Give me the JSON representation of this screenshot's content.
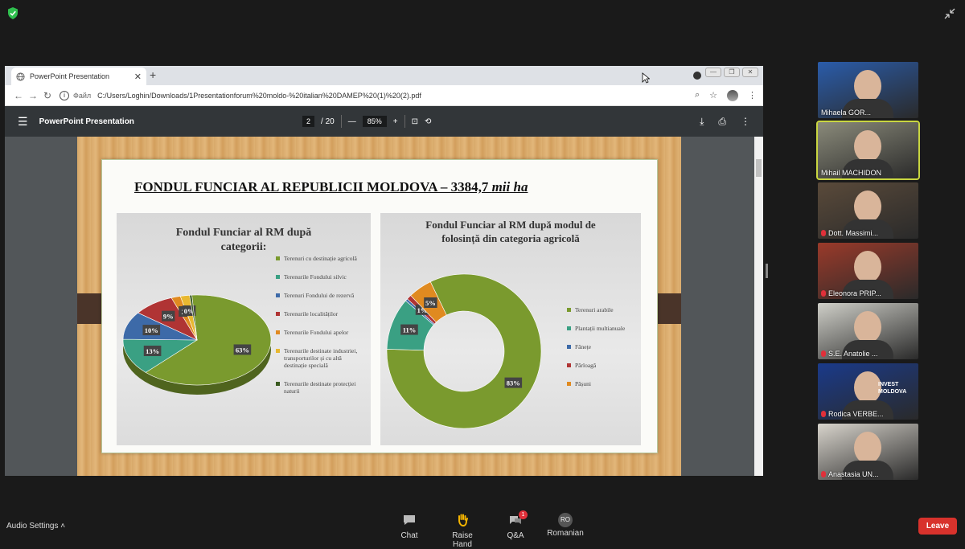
{
  "browser": {
    "tab_title": "PowerPoint Presentation",
    "tab_close": "✕",
    "new_tab": "+",
    "file_label": "Файл",
    "url": "C:/Users/Loghin/Downloads/1Presentationforum%20moldo-%20italian%20DAMEP%20(1)%20(2).pdf"
  },
  "pdf": {
    "title": "PowerPoint Presentation",
    "page_current": "2",
    "page_total": "/ 20",
    "zoom": "85%"
  },
  "slide": {
    "title_main": "FONDUL FUNCIAR AL REPUBLICII MOLDOVA  – 3384,7 ",
    "title_unit": "mii ha",
    "left_title_1": "Fondul Funciar al RM după",
    "left_title_2": "categorii:",
    "right_title_1": "Fondul Funciar al RM după modul de",
    "right_title_2": "folosință din categoria agricolă"
  },
  "chart_data": [
    {
      "type": "pie",
      "title": "Fondul Funciar al RM după categorii:",
      "categories": [
        "Terenuri cu destinație agricolă",
        "Terenurile Fondului silvic",
        "Terenuri Fondului de rezervă",
        "Terenurile localităților",
        "Terenurile Fondului apelor",
        "Terenurile destinate industriei, transporturilor și cu altă destinație specială",
        "Terenurile destinate protecției naturii"
      ],
      "labels": [
        "63%",
        "13%",
        "10%",
        "9%",
        "2",
        "0%",
        ""
      ],
      "values": [
        63,
        13,
        10,
        9,
        2,
        2,
        0.5
      ],
      "colors": [
        "#7a9a2e",
        "#3aa083",
        "#3d6aa8",
        "#b03434",
        "#e08a20",
        "#e8b830",
        "#3a5a20"
      ]
    },
    {
      "type": "pie",
      "title": "Fondul Funciar al RM după modul de folosință din categoria agricolă",
      "categories": [
        "Terenuri arabile",
        "Plantații multianuale",
        "Fânețe",
        "Pârloagă",
        "Pășuni"
      ],
      "labels": [
        "83%",
        "11%",
        "",
        "1%",
        "5%"
      ],
      "values": [
        83,
        11,
        0.5,
        1,
        5
      ],
      "colors": [
        "#7a9a2e",
        "#3aa083",
        "#3d6aa8",
        "#b03434",
        "#e08a20"
      ]
    }
  ],
  "participants": [
    {
      "name": "Mihaela GOR...",
      "bg": "#2a5caa",
      "active": false,
      "muted": false
    },
    {
      "name": "Mihail MACHIDON",
      "bg": "#8a8a7a",
      "active": true,
      "muted": false
    },
    {
      "name": "Dott. Massimi...",
      "bg": "#5a4a3a",
      "active": false,
      "muted": true
    },
    {
      "name": "Eleonora PRIP...",
      "bg": "#9a3a2a",
      "active": false,
      "muted": true
    },
    {
      "name": "S.E. Anatolie ...",
      "bg": "#cfcfc8",
      "active": false,
      "muted": true
    },
    {
      "name": "Rodica VERBE...",
      "bg": "#1a3a8a",
      "active": false,
      "muted": true
    },
    {
      "name": "Anastasia UN...",
      "bg": "#d8d4cc",
      "active": false,
      "muted": true
    }
  ],
  "tile_logo": "INVEST MOLDOVA",
  "bottom": {
    "audio_settings": "Audio Settings",
    "chat": "Chat",
    "raise_hand": "Raise Hand",
    "qa": "Q&A",
    "qa_badge": "1",
    "language_code": "RO",
    "language": "Romanian",
    "leave": "Leave"
  }
}
